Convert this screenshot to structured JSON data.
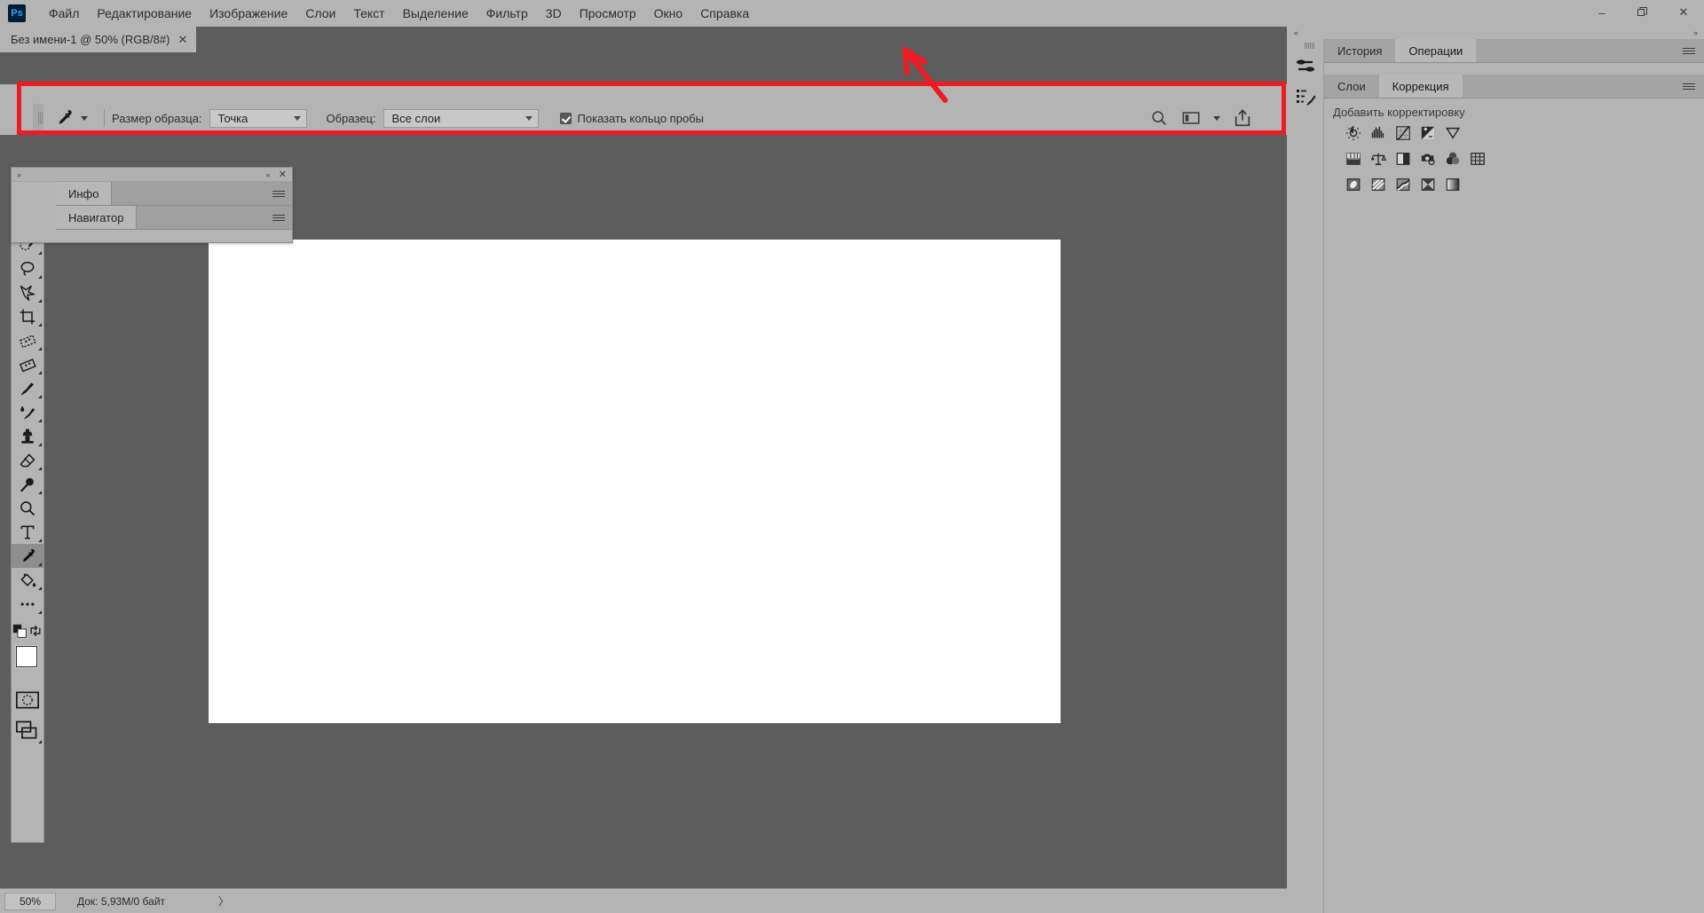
{
  "app": {
    "logo_text": "Ps"
  },
  "menubar": {
    "items": [
      {
        "label": "Файл"
      },
      {
        "label": "Редактирование"
      },
      {
        "label": "Изображение"
      },
      {
        "label": "Слои"
      },
      {
        "label": "Текст"
      },
      {
        "label": "Выделение"
      },
      {
        "label": "Фильтр"
      },
      {
        "label": "3D"
      },
      {
        "label": "Просмотр"
      },
      {
        "label": "Окно"
      },
      {
        "label": "Справка"
      }
    ]
  },
  "window_controls": {
    "minimize": "–",
    "restore": "❐",
    "close": "✕"
  },
  "document_tab": {
    "title": "Без имени-1 @ 50% (RGB/8#)",
    "close": "✕"
  },
  "options_bar": {
    "tool_icon": "eyedropper-icon",
    "sample_size_label": "Размер образца:",
    "sample_size_value": "Точка",
    "sample_label": "Образец:",
    "sample_value": "Все слои",
    "show_ring_label": "Показать кольцо пробы",
    "show_ring_checked": true,
    "right_icons": [
      "search-icon",
      "workspace-icon",
      "chevron-down-icon",
      "share-icon"
    ]
  },
  "annotation": {
    "color": "#ee1c22",
    "shape": "rectangle-and-arrow"
  },
  "toolbar": {
    "tools": [
      {
        "name": "move-tool",
        "active": false,
        "more": true
      },
      {
        "name": "rectangular-marquee-tool",
        "active": false,
        "more": true
      },
      {
        "name": "quick-selection-tool",
        "active": false,
        "more": true
      },
      {
        "name": "lasso-tool",
        "active": false,
        "more": true
      },
      {
        "name": "magic-wand-tool",
        "active": false,
        "more": true
      },
      {
        "name": "crop-tool",
        "active": false,
        "more": true
      },
      {
        "name": "frame-tool",
        "active": false,
        "more": true
      },
      {
        "name": "spot-healing-brush-tool",
        "active": false,
        "more": true
      },
      {
        "name": "brush-tool",
        "active": false,
        "more": true
      },
      {
        "name": "mixer-brush-tool",
        "active": false,
        "more": true
      },
      {
        "name": "clone-stamp-tool",
        "active": false,
        "more": true
      },
      {
        "name": "eraser-tool",
        "active": false,
        "more": true
      },
      {
        "name": "blur-tool",
        "active": false,
        "more": true
      },
      {
        "name": "zoom-tool",
        "active": false,
        "more": false
      },
      {
        "name": "type-tool",
        "active": false,
        "more": true
      },
      {
        "name": "eyedropper-tool",
        "active": true,
        "more": true
      },
      {
        "name": "paint-bucket-tool",
        "active": false,
        "more": true
      },
      {
        "name": "edit-toolbar-tool",
        "active": false,
        "more": true
      }
    ],
    "foreground_color": "#ffffff",
    "background_color": "#000000",
    "bottom_tools": [
      {
        "name": "default-colors-icon"
      },
      {
        "name": "swap-colors-icon"
      },
      {
        "name": "quick-mask-icon"
      },
      {
        "name": "screen-mode-icon"
      }
    ]
  },
  "float_panel": {
    "expand_icon": "»",
    "collapse_icon": "«",
    "close_icon": "✕",
    "tabs_top": [
      {
        "label": "Инфо",
        "active": true
      }
    ],
    "tabs_bottom": [
      {
        "label": "Навигатор",
        "active": true
      }
    ]
  },
  "canvas": {
    "document_color": "#ffffff",
    "background_color": "#5d5d5d"
  },
  "statusbar": {
    "zoom": "50%",
    "doc_info": "Док: 5,93M/0 байт",
    "expand_arrow": "〉"
  },
  "right_dock": {
    "collapse_left": "«",
    "collapse_right": "»",
    "rail_icons": [
      "adjustments-rail-icon",
      "styles-rail-icon"
    ],
    "group_top": {
      "tabs": [
        {
          "label": "История",
          "active": false
        },
        {
          "label": "Операции",
          "active": true
        }
      ],
      "menu_icon": "panel-menu-icon"
    },
    "group_bottom": {
      "tabs": [
        {
          "label": "Слои",
          "active": false
        },
        {
          "label": "Коррекция",
          "active": true
        }
      ],
      "menu_icon": "panel-menu-icon",
      "adjustments_title": "Добавить корректировку",
      "adjustment_rows": [
        [
          {
            "name": "brightness-contrast-icon"
          },
          {
            "name": "levels-icon"
          },
          {
            "name": "curves-icon"
          },
          {
            "name": "exposure-icon"
          },
          {
            "name": "vibrance-icon"
          }
        ],
        [
          {
            "name": "hue-saturation-icon"
          },
          {
            "name": "color-balance-icon"
          },
          {
            "name": "black-white-icon"
          },
          {
            "name": "photo-filter-icon"
          },
          {
            "name": "channel-mixer-icon"
          },
          {
            "name": "color-lookup-icon"
          }
        ],
        [
          {
            "name": "invert-icon"
          },
          {
            "name": "posterize-icon"
          },
          {
            "name": "threshold-icon"
          },
          {
            "name": "gradient-map-icon"
          },
          {
            "name": "selective-color-icon"
          }
        ]
      ]
    }
  }
}
